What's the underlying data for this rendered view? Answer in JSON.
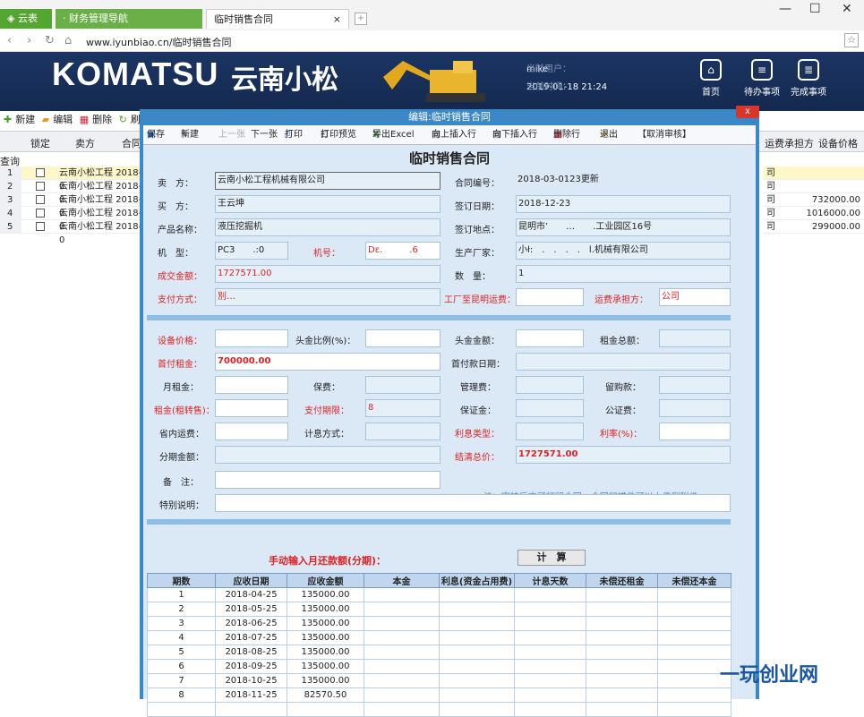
{
  "browser": {
    "tabs": [
      {
        "label": "云表"
      },
      {
        "label": "财务管理导航"
      },
      {
        "label": "临时销售合同",
        "close": "×"
      }
    ],
    "url": "www.iyunbiao.cn/临时销售合同"
  },
  "header": {
    "logo": "KOMATSU",
    "brand_cn": "云南小松",
    "current_user_label": "当前用户：",
    "current_user": "mike",
    "current_time_label": "当前时间：",
    "current_time": "2019-01-18 21:24",
    "nav": [
      {
        "label": "首页",
        "icon": "home-icon"
      },
      {
        "label": "待办事项",
        "icon": "todo-icon"
      },
      {
        "label": "完成事项",
        "icon": "done-icon"
      }
    ]
  },
  "list": {
    "toolbar": [
      "新建",
      "编辑",
      "删除",
      "刷"
    ],
    "columns": {
      "lock": "锁定",
      "seller": "卖方",
      "contract": "合同",
      "freight_payer": "运费承担方",
      "device_price": "设备价格"
    },
    "query": "查询",
    "rows": [
      {
        "num": "1",
        "seller": "云南小松工程",
        "date": "2018-0",
        "payer": "司",
        "price": ""
      },
      {
        "num": "2",
        "seller": "云南小松工程",
        "date": "2018-0",
        "payer": "司",
        "price": ""
      },
      {
        "num": "3",
        "seller": "云南小松工程",
        "date": "2018-0",
        "payer": "司",
        "price": "732000.00"
      },
      {
        "num": "4",
        "seller": "云南小松工程",
        "date": "2018-0",
        "payer": "司",
        "price": "1016000.00"
      },
      {
        "num": "5",
        "seller": "云南小松工程",
        "date": "2018-0",
        "payer": "司",
        "price": "299000.00"
      }
    ]
  },
  "dialog": {
    "title": "编辑:临时销售合同",
    "close": "x",
    "toolbar": {
      "save": "保存",
      "new": "新建",
      "prev": "上一张",
      "next": "下一张",
      "print": "打印",
      "preview": "打印预览",
      "export": "导出Excel",
      "insert_up": "向上插入行",
      "insert_down": "向下插入行",
      "delete_row": "删除行",
      "exit": "退出",
      "cancel_audit": "【取消审核】"
    },
    "form_title": "临时销售合同"
  },
  "form": {
    "seller_label": "卖　方：",
    "seller": "云南小松工程机械有限公司",
    "contract_no_label": "合同编号：",
    "contract_no": "2018-03-0123更新",
    "buyer_label": "买　方：",
    "buyer": "王云坤",
    "sign_date_label": "签订日期：",
    "sign_date": "2018-12-23",
    "product_label": "产品名称：",
    "product": "液压挖掘机",
    "sign_place_label": "签订地点：",
    "sign_place": "昆明市’　　…　　.工业园区16号",
    "model_label": "机　型：",
    "model": "PC3　　.:0",
    "machine_no_label": "机号：",
    "machine_no": "Dε.　　　.6",
    "manufacturer_label": "生产厂家：",
    "manufacturer": "小ł:　.　.　.　.　l.机械有限公司",
    "amount_label": "成交金额：",
    "amount": "1727571.00",
    "qty_label": "数　量：",
    "qty": "1",
    "payment_label": "支付方式：",
    "payment": "別…",
    "freight_label": "工厂至昆明运费：",
    "freight": "",
    "freight_payer_label": "运费承担方：",
    "freight_payer": "公司",
    "device_price_label": "设备价格：",
    "device_price": "",
    "down_ratio_label": "头金比例(%)：",
    "down_ratio": "",
    "down_amount_label": "头金金额：",
    "down_amount": "",
    "rent_total_label": "租金总额：",
    "rent_total": "",
    "first_rent_label": "首付租金：",
    "first_rent": "700000.00",
    "first_pay_date_label": "首付款日期：",
    "first_pay_date": "",
    "monthly_rent_label": "月租金：",
    "monthly_rent": "",
    "insurance_label": "保费：",
    "insurance": "",
    "mgmt_fee_label": "管理费：",
    "mgmt_fee": "",
    "buyback_label": "留购款：",
    "buyback": "",
    "rent_sale_label": "租金(租转售)：",
    "rent_sale": "",
    "periods_label": "支付期限：",
    "periods": "8",
    "deposit_label": "保证金：",
    "deposit": "",
    "notary_label": "公证费：",
    "notary": "",
    "local_freight_label": "省内运费：",
    "local_freight": "",
    "interest_method_label": "计息方式：",
    "interest_method": "",
    "interest_type_label": "利息类型：",
    "interest_type": "",
    "rate_label": "利率(%)：",
    "rate": "",
    "installment_label": "分期金额：",
    "installment": "",
    "settle_label": "结清总价：",
    "settle": "1727571.00",
    "remark_label": "备　注：",
    "remark": "",
    "note": "注：审核后方可打印合同，合同扫描件可以上传到附件",
    "special_label": "特别说明：",
    "special": ""
  },
  "schedule": {
    "manual_label": "手动输入月还款额(分期)：",
    "calc_button": "计　算",
    "columns": [
      "期数",
      "应收日期",
      "应收金额",
      "本金",
      "利息(资金占用费)",
      "计息天数",
      "未偿还租金",
      "未偿还本金"
    ],
    "rows": [
      [
        "1",
        "2018-04-25",
        "135000.00"
      ],
      [
        "2",
        "2018-05-25",
        "135000.00"
      ],
      [
        "3",
        "2018-06-25",
        "135000.00"
      ],
      [
        "4",
        "2018-07-25",
        "135000.00"
      ],
      [
        "5",
        "2018-08-25",
        "135000.00"
      ],
      [
        "6",
        "2018-09-25",
        "135000.00"
      ],
      [
        "7",
        "2018-10-25",
        "135000.00"
      ],
      [
        "8",
        "2018-11-25",
        "82570.50"
      ]
    ]
  },
  "watermark": "一玩创业网"
}
